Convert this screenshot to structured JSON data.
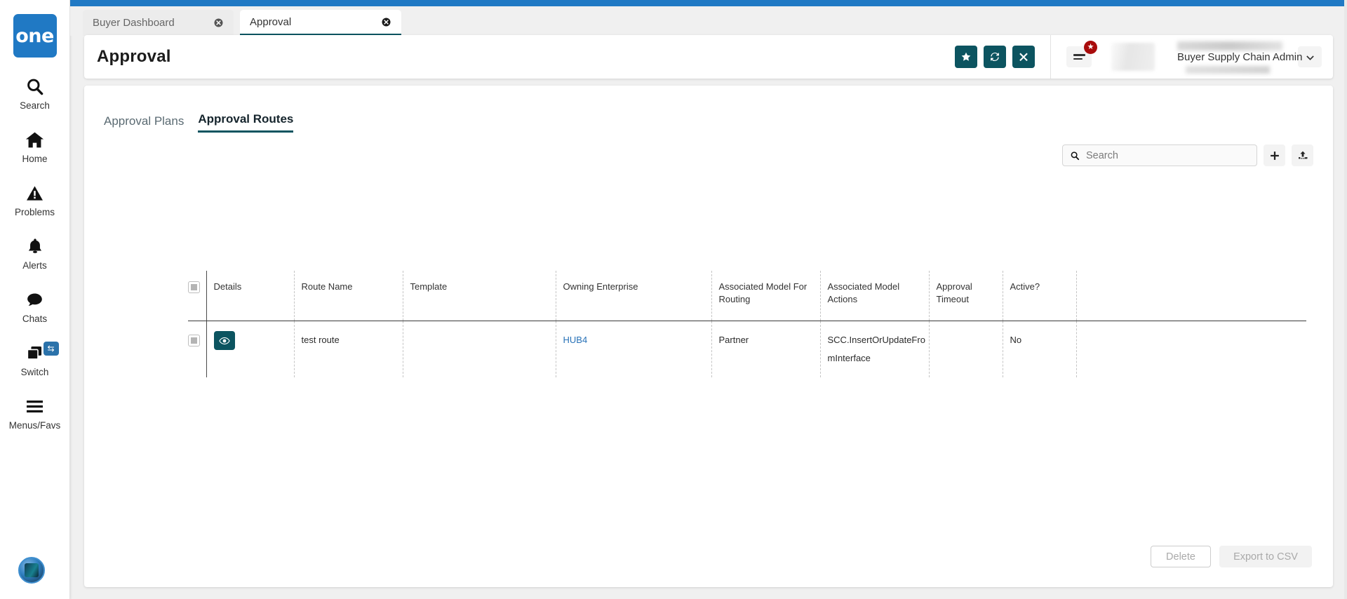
{
  "theme": {
    "brand_blue": "#2079c4",
    "accent_teal": "#0c5460",
    "link_blue": "#2872b8",
    "badge_red": "#a90c0c"
  },
  "rail": {
    "logo_text": "one",
    "items": [
      {
        "label": "Search",
        "icon": "search-icon"
      },
      {
        "label": "Home",
        "icon": "home-icon"
      },
      {
        "label": "Problems",
        "icon": "warning-triangle-icon"
      },
      {
        "label": "Alerts",
        "icon": "bell-icon"
      },
      {
        "label": "Chats",
        "icon": "chat-bubble-icon"
      },
      {
        "label": "Switch",
        "icon": "windows-stack-icon",
        "badge_icon": "swap-arrows-icon"
      },
      {
        "label": "Menus/Favs",
        "icon": "hamburger-icon"
      }
    ]
  },
  "tabs": [
    {
      "label": "Buyer Dashboard",
      "active": false
    },
    {
      "label": "Approval",
      "active": true
    }
  ],
  "header": {
    "title": "Approval",
    "actions": [
      {
        "name": "favorite-button",
        "icon": "star-icon"
      },
      {
        "name": "refresh-button",
        "icon": "refresh-icon"
      },
      {
        "name": "close-button",
        "icon": "x-icon"
      }
    ],
    "menu_badge": "★",
    "user_role": "Buyer Supply Chain Admin"
  },
  "subtabs": [
    {
      "label": "Approval Plans",
      "active": false
    },
    {
      "label": "Approval Routes",
      "active": true
    }
  ],
  "toolbar": {
    "search_placeholder": "Search",
    "search_value": "",
    "add_label": "+",
    "upload_icon": "upload-icon"
  },
  "table": {
    "columns": [
      "Details",
      "Route Name",
      "Template",
      "Owning Enterprise",
      "Associated Model For Routing",
      "Associated Model Actions",
      "Approval Timeout",
      "Active?"
    ],
    "rows": [
      {
        "details_icon": "eye-icon",
        "route_name": "test route",
        "template": "",
        "owning_enterprise": "HUB4",
        "associated_model_for_routing": "Partner",
        "associated_model_actions": "SCC.InsertOrUpdateFromInterface",
        "approval_timeout": "",
        "active": "No"
      }
    ]
  },
  "footer": {
    "delete_label": "Delete",
    "export_label": "Export to CSV"
  }
}
